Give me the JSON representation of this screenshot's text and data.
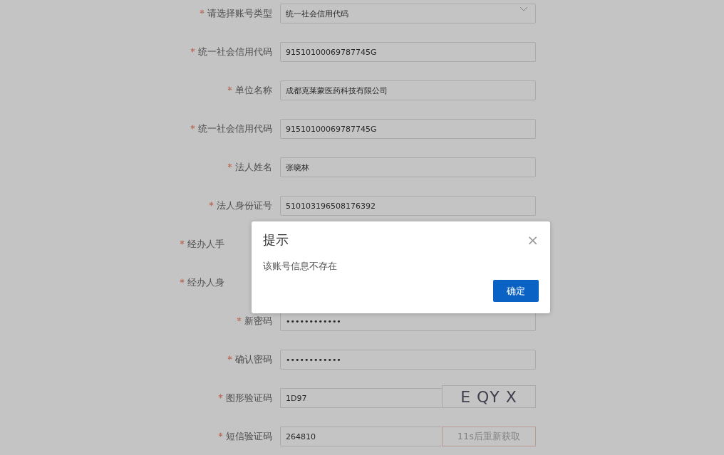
{
  "form": {
    "rows": [
      {
        "label": "请选择账号类型",
        "required": true,
        "kind": "select",
        "value": "统一社会信用代码"
      },
      {
        "label": "统一社会信用代码",
        "required": true,
        "kind": "text",
        "value": "91510100069787745G"
      },
      {
        "label": "单位名称",
        "required": true,
        "kind": "text",
        "value": "成都克莱蒙医药科技有限公司"
      },
      {
        "label": "统一社会信用代码",
        "required": true,
        "kind": "text",
        "value": "91510100069787745G"
      },
      {
        "label": "法人姓名",
        "required": true,
        "kind": "text",
        "value": "张晓林"
      },
      {
        "label": "法人身份证号",
        "required": true,
        "kind": "text",
        "value": "510103196508176392"
      },
      {
        "label": "经办人手",
        "required": true,
        "kind": "hidden"
      },
      {
        "label": "经办人身",
        "required": true,
        "kind": "hidden"
      },
      {
        "label": "新密码",
        "required": true,
        "kind": "text",
        "value": "••••••••••••"
      },
      {
        "label": "确认密码",
        "required": true,
        "kind": "text",
        "value": "••••••••••••"
      },
      {
        "label": "图形验证码",
        "required": true,
        "kind": "captcha",
        "value": "1D97",
        "side": "E QY X"
      },
      {
        "label": "短信验证码",
        "required": true,
        "kind": "sms",
        "value": "264810",
        "side": "11s后重新获取",
        "disabled": true
      }
    ]
  },
  "dialog": {
    "title": "提示",
    "close": "×",
    "message": "该账号信息不存在",
    "button": "确定"
  }
}
